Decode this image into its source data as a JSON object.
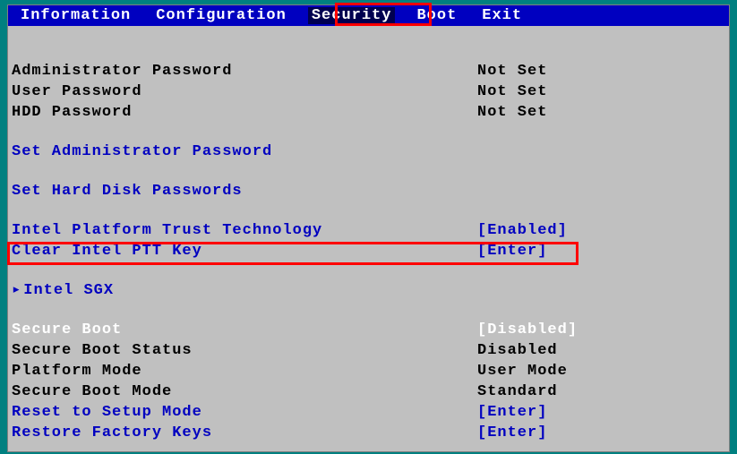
{
  "menu": {
    "items": [
      {
        "label": "Information",
        "selected": false
      },
      {
        "label": "Configuration",
        "selected": false
      },
      {
        "label": "Security",
        "selected": true
      },
      {
        "label": "Boot",
        "selected": false
      },
      {
        "label": "Exit",
        "selected": false
      }
    ]
  },
  "security": {
    "admin_password_label": "Administrator Password",
    "admin_password_value": "Not Set",
    "user_password_label": "User Password",
    "user_password_value": "Not Set",
    "hdd_password_label": "HDD Password",
    "hdd_password_value": "Not Set",
    "set_admin_password": "Set Administrator Password",
    "set_hdd_passwords": "Set Hard Disk Passwords",
    "intel_ptt_label": "Intel Platform Trust Technology",
    "intel_ptt_value": "[Enabled]",
    "clear_ptt_label": "Clear Intel PTT Key",
    "clear_ptt_value": "[Enter]",
    "intel_sgx": "Intel SGX",
    "secure_boot_label": "Secure Boot",
    "secure_boot_value": "[Disabled]",
    "secure_boot_status_label": "Secure Boot Status",
    "secure_boot_status_value": "Disabled",
    "platform_mode_label": "Platform Mode",
    "platform_mode_value": "User Mode",
    "secure_boot_mode_label": "Secure Boot Mode",
    "secure_boot_mode_value": "Standard",
    "reset_setup_label": "Reset to Setup Mode",
    "reset_setup_value": "[Enter]",
    "restore_factory_label": "Restore Factory Keys",
    "restore_factory_value": "[Enter]"
  },
  "arrow": "▸"
}
